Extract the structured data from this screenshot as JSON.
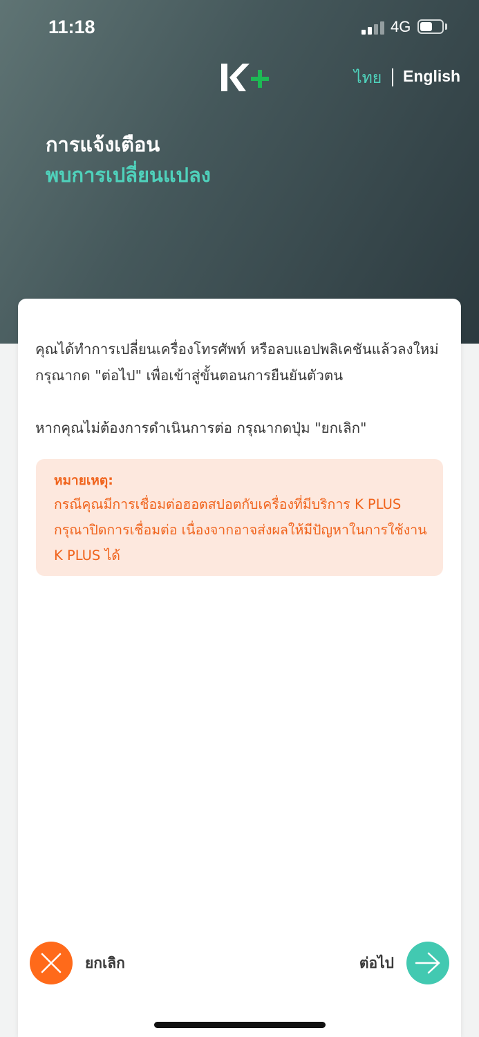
{
  "status_bar": {
    "time": "11:18",
    "network": "4G"
  },
  "brand": {
    "logo_text": "K+",
    "primary_color": "#ffffff",
    "accent_color": "#1db954"
  },
  "language": {
    "thai": "ไทย",
    "english": "English",
    "selected": "ไทย"
  },
  "header": {
    "title": "การแจ้งเตือน",
    "subtitle": "พบการเปลี่ยนแปลง"
  },
  "card": {
    "message_1": "คุณได้ทำการเปลี่ยนเครื่องโทรศัพท์ หรือลบแอปพลิเคชันแล้วลงใหม่ กรุณากด \"ต่อไป\" เพื่อเข้าสู่ขั้นตอนการยืนยันตัวตน",
    "message_2": "หากคุณไม่ต้องการดำเนินการต่อ กรุณากดปุ่ม \"ยกเลิก\"",
    "note": {
      "title": "หมายเหตุ:",
      "body": "กรณีคุณมีการเชื่อมต่อฮอตสปอตกับเครื่องที่มีบริการ K PLUS กรุณาปิดการเชื่อมต่อ เนื่องจากอาจส่งผลให้มีปัญหาในการใช้งาน K PLUS ได้"
    }
  },
  "actions": {
    "cancel_label": "ยกเลิก",
    "next_label": "ต่อไป",
    "cancel_icon": "close-icon",
    "next_icon": "arrow-right-icon"
  },
  "colors": {
    "accent_teal": "#42c9b1",
    "cancel_orange": "#ff6a1a",
    "note_text": "#f0641d",
    "note_bg": "#fde8de"
  }
}
